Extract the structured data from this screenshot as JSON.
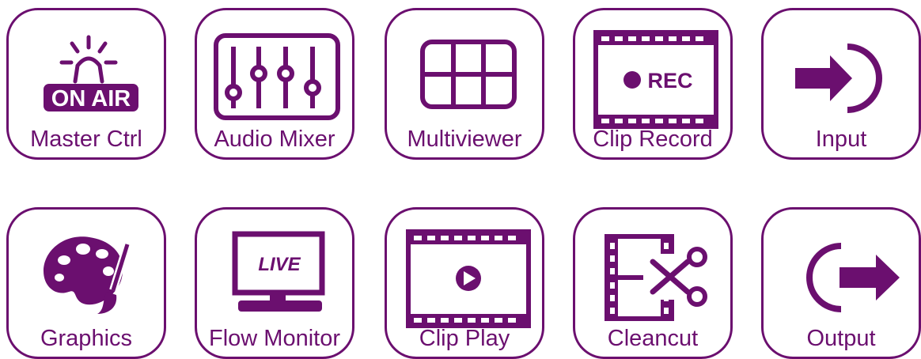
{
  "theme": {
    "accent": "#6b0f6f",
    "background": "#ffffff"
  },
  "tiles": [
    {
      "label": "Master Ctrl",
      "icon": "on-air-icon",
      "icon_text": "ON AIR"
    },
    {
      "label": "Audio Mixer",
      "icon": "mixer-faders-icon"
    },
    {
      "label": "Multiviewer",
      "icon": "multiview-grid-icon"
    },
    {
      "label": "Clip Record",
      "icon": "rec-film-icon",
      "icon_text": "REC"
    },
    {
      "label": "Input",
      "icon": "input-arrow-icon"
    },
    {
      "label": "Graphics",
      "icon": "palette-brush-icon"
    },
    {
      "label": "Flow Monitor",
      "icon": "live-monitor-icon",
      "icon_text": "LIVE"
    },
    {
      "label": "Clip Play",
      "icon": "play-film-icon"
    },
    {
      "label": "Cleancut",
      "icon": "film-scissors-icon"
    },
    {
      "label": "Output",
      "icon": "output-arrow-icon"
    }
  ]
}
